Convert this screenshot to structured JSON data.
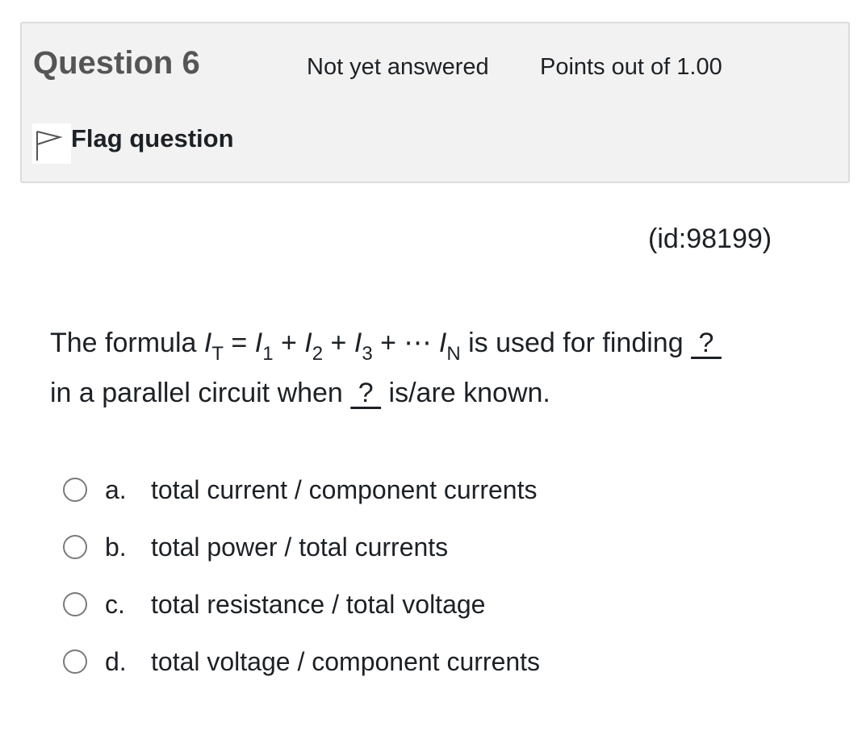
{
  "question": {
    "title": "Question 6",
    "state": "Not yet answered",
    "grade": "Points out of 1.00",
    "flag_label": "Flag question",
    "flag_icon": "flag-outline-icon",
    "id_text": "(id:98199)"
  },
  "question_text": {
    "line1_prefix": "The formula ",
    "I": "I",
    "sub_T": "T",
    "eq": " = ",
    "sub_1": "1",
    "plus1": " + ",
    "sub_2": "2",
    "plus2": " + ",
    "sub_3": "3",
    "plus3": " + ⋯ ",
    "sub_N": "N",
    "line1_suffix": " is used for finding ",
    "blank1": " ? ",
    "line2_prefix": "in a parallel circuit when ",
    "blank2": " ? ",
    "line2_suffix": " is/are known."
  },
  "answers": [
    {
      "letter": "a.",
      "text": "total current / component currents"
    },
    {
      "letter": "b.",
      "text": "total power / total currents"
    },
    {
      "letter": "c.",
      "text": "total resistance / total voltage"
    },
    {
      "letter": "d.",
      "text": "total voltage / component currents"
    }
  ],
  "colors": {
    "info_bg": "#f2f2f2",
    "info_border": "#dcdcdc",
    "title": "#555555",
    "text": "#1d2125",
    "radio_border": "#7a7a7a"
  }
}
